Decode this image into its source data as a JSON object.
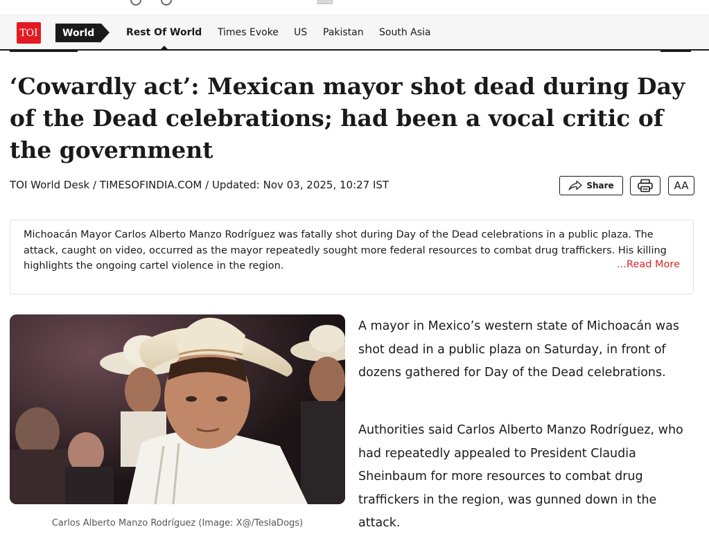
{
  "top_strip": {
    "text": "(...) (...) g ... ... ... ... y ..."
  },
  "nav": {
    "logo": "TOI",
    "section": "World",
    "items": [
      {
        "label": "Rest Of World",
        "active": true
      },
      {
        "label": "Times Evoke",
        "active": false
      },
      {
        "label": "US",
        "active": false
      },
      {
        "label": "Pakistan",
        "active": false
      },
      {
        "label": "South Asia",
        "active": false
      }
    ]
  },
  "article": {
    "headline": "‘Cowardly act’: Mexican mayor shot dead during Day of the Dead celebrations; had been a vocal critic of the government",
    "byline": "TOI World Desk / TIMESOFINDIA.COM / Updated: Nov 03, 2025, 10:27 IST",
    "share_label": "Share",
    "font_size_label": "AA",
    "summary": "Michoacán Mayor Carlos Alberto Manzo Rodríguez was fatally shot during Day of the Dead celebrations in a public plaza. The attack, caught on video, occurred as the mayor repeatedly sought more federal resources to combat drug traffickers. His killing highlights the ongoing cartel violence in the region.",
    "read_more": "...Read More",
    "image_caption": "Carlos Alberto Manzo Rodríguez (Image: X@/TeslaDogs)",
    "paragraphs": [
      "A mayor in Mexico’s western state of Michoacán was shot dead in a public plaza on Saturday, in front of dozens gathered for Day of the Dead celebrations.",
      "Authorities said Carlos Alberto Manzo Rodríguez, who had repeatedly appealed to President Claudia Sheinbaum for more resources to combat drug traffickers in the region, was gunned down in the attack."
    ]
  },
  "colors": {
    "brand_red": "#e21b22",
    "read_more": "#d42a2a",
    "text": "#1a1a1a"
  },
  "icons": [
    "share-icon",
    "print-icon"
  ]
}
